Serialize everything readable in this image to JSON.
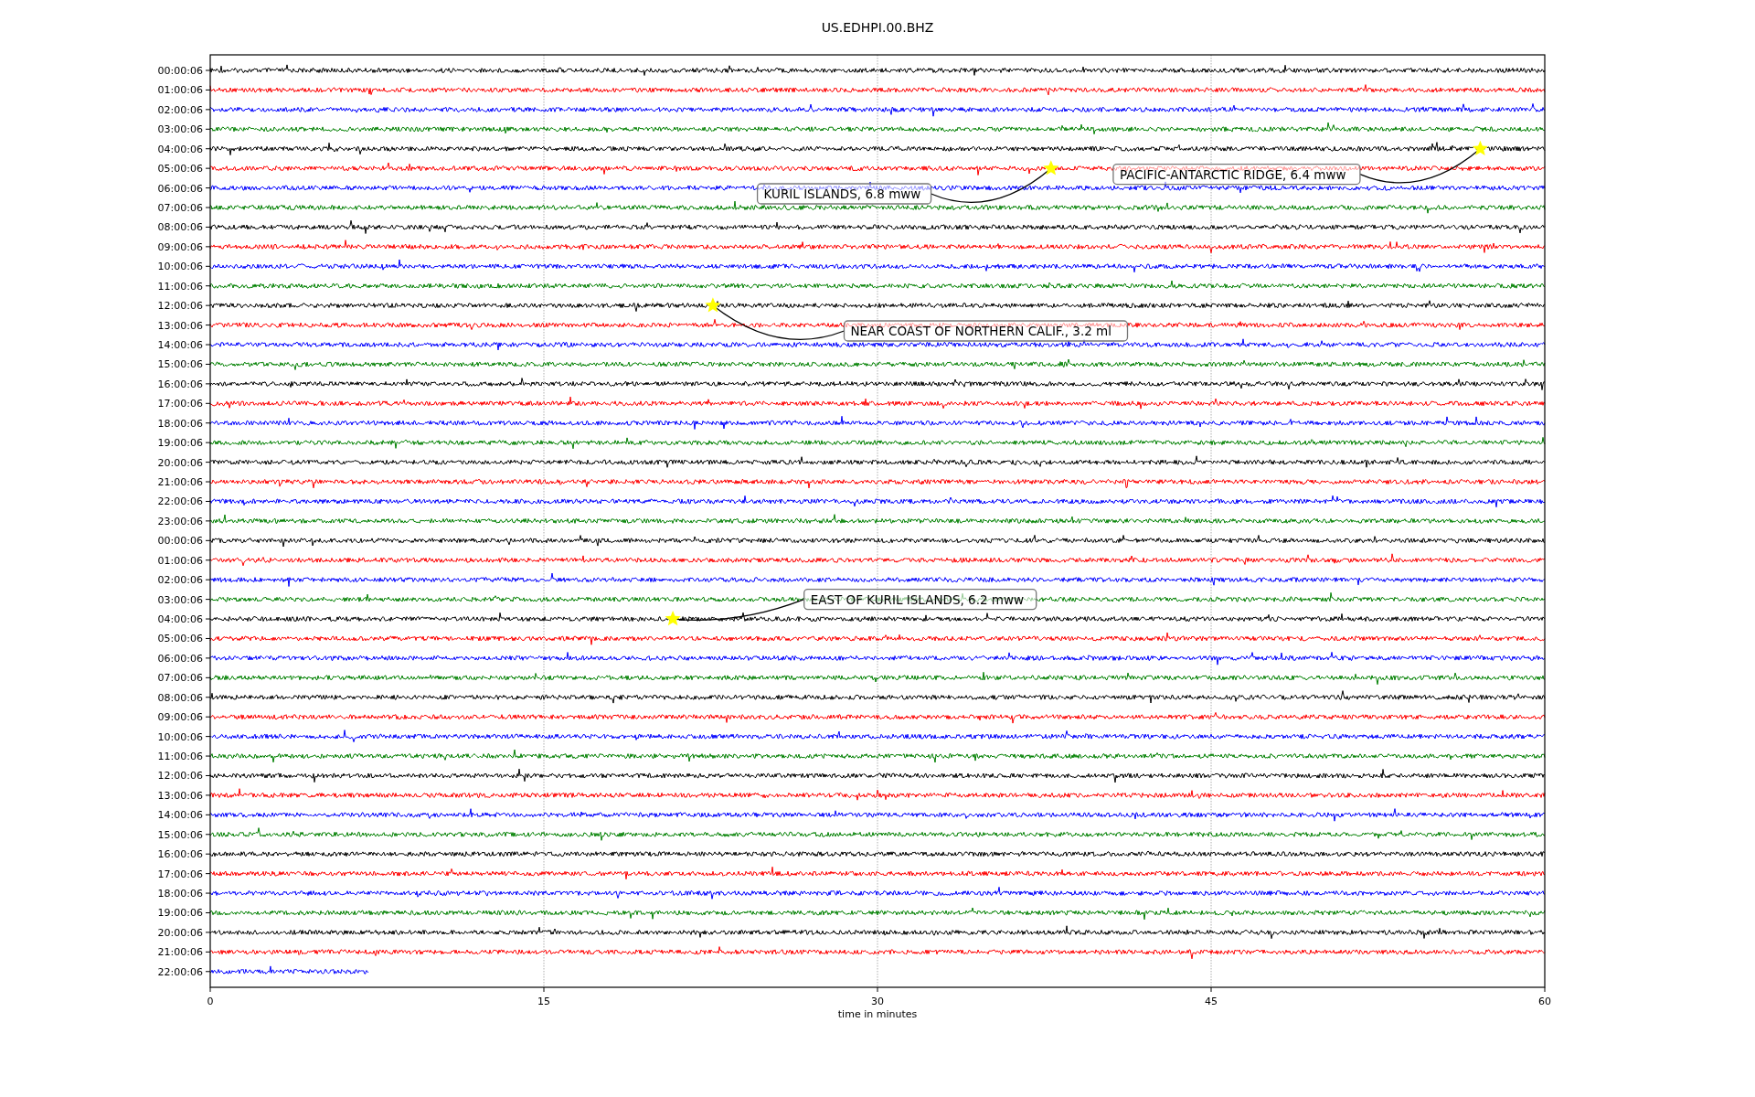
{
  "plot": {
    "title": "US.EDHPI.00.BHZ",
    "xlabel": "time in minutes",
    "x_ticks": [
      "0",
      "15",
      "30",
      "45",
      "60"
    ],
    "rows": [
      {
        "label": "00:00:06",
        "color": "#000000"
      },
      {
        "label": "01:00:06",
        "color": "#ff0000"
      },
      {
        "label": "02:00:06",
        "color": "#0000ff"
      },
      {
        "label": "03:00:06",
        "color": "#008000"
      },
      {
        "label": "04:00:06",
        "color": "#000000"
      },
      {
        "label": "05:00:06",
        "color": "#ff0000"
      },
      {
        "label": "06:00:06",
        "color": "#0000ff"
      },
      {
        "label": "07:00:06",
        "color": "#008000"
      },
      {
        "label": "08:00:06",
        "color": "#000000"
      },
      {
        "label": "09:00:06",
        "color": "#ff0000"
      },
      {
        "label": "10:00:06",
        "color": "#0000ff"
      },
      {
        "label": "11:00:06",
        "color": "#008000"
      },
      {
        "label": "12:00:06",
        "color": "#000000"
      },
      {
        "label": "13:00:06",
        "color": "#ff0000"
      },
      {
        "label": "14:00:06",
        "color": "#0000ff"
      },
      {
        "label": "15:00:06",
        "color": "#008000"
      },
      {
        "label": "16:00:06",
        "color": "#000000"
      },
      {
        "label": "17:00:06",
        "color": "#ff0000"
      },
      {
        "label": "18:00:06",
        "color": "#0000ff"
      },
      {
        "label": "19:00:06",
        "color": "#008000"
      },
      {
        "label": "20:00:06",
        "color": "#000000"
      },
      {
        "label": "21:00:06",
        "color": "#ff0000"
      },
      {
        "label": "22:00:06",
        "color": "#0000ff"
      },
      {
        "label": "23:00:06",
        "color": "#008000"
      },
      {
        "label": "00:00:06",
        "color": "#000000"
      },
      {
        "label": "01:00:06",
        "color": "#ff0000"
      },
      {
        "label": "02:00:06",
        "color": "#0000ff"
      },
      {
        "label": "03:00:06",
        "color": "#008000"
      },
      {
        "label": "04:00:06",
        "color": "#000000"
      },
      {
        "label": "05:00:06",
        "color": "#ff0000"
      },
      {
        "label": "06:00:06",
        "color": "#0000ff"
      },
      {
        "label": "07:00:06",
        "color": "#008000"
      },
      {
        "label": "08:00:06",
        "color": "#000000"
      },
      {
        "label": "09:00:06",
        "color": "#ff0000"
      },
      {
        "label": "10:00:06",
        "color": "#0000ff"
      },
      {
        "label": "11:00:06",
        "color": "#008000"
      },
      {
        "label": "12:00:06",
        "color": "#000000"
      },
      {
        "label": "13:00:06",
        "color": "#ff0000"
      },
      {
        "label": "14:00:06",
        "color": "#0000ff"
      },
      {
        "label": "15:00:06",
        "color": "#008000"
      },
      {
        "label": "16:00:06",
        "color": "#000000"
      },
      {
        "label": "17:00:06",
        "color": "#ff0000"
      },
      {
        "label": "18:00:06",
        "color": "#0000ff"
      },
      {
        "label": "19:00:06",
        "color": "#008000"
      },
      {
        "label": "20:00:06",
        "color": "#000000"
      },
      {
        "label": "21:00:06",
        "color": "#ff0000"
      },
      {
        "label": "22:00:06",
        "color": "#0000ff"
      }
    ],
    "events": [
      {
        "text": "KURIL ISLANDS, 6.8 mww"
      },
      {
        "text": "PACIFIC-ANTARCTIC RIDGE, 6.4 mww"
      },
      {
        "text": "NEAR COAST OF NORTHERN CALIF., 3.2 ml"
      },
      {
        "text": "EAST OF KURIL ISLANDS, 6.2 mww"
      }
    ]
  }
}
